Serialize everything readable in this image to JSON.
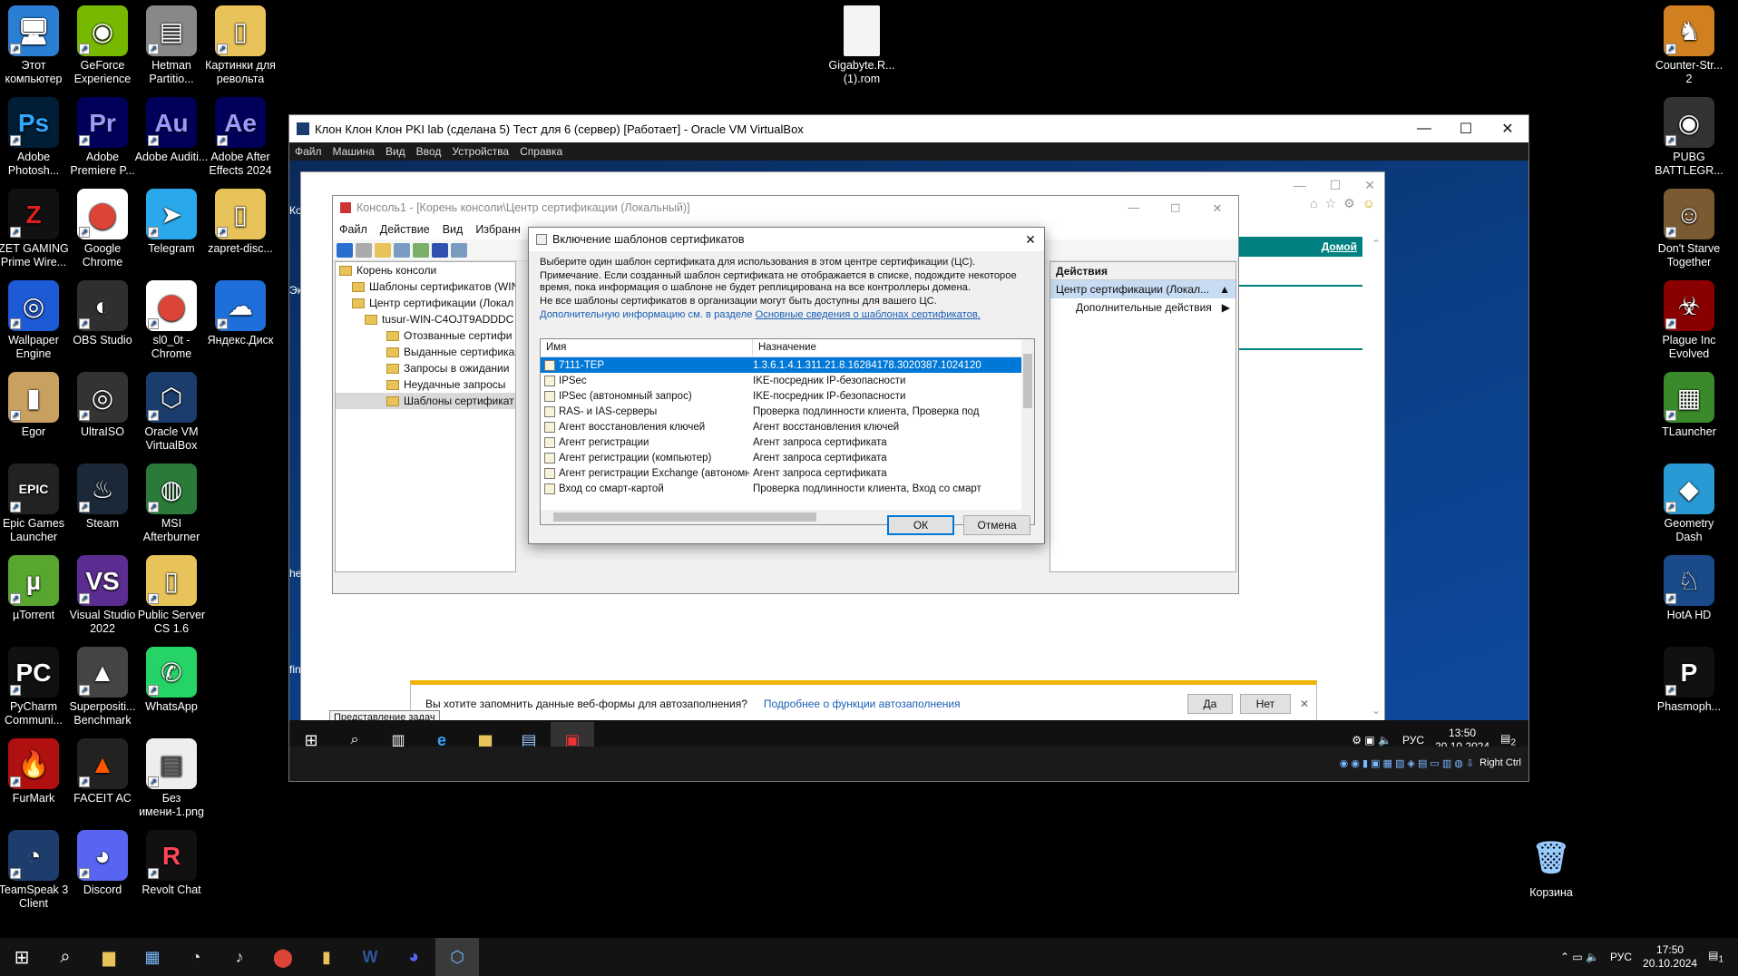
{
  "desktop_left": [
    {
      "l": "Этот компьютер",
      "bg": "#2a7fd4",
      "g": "🖥"
    },
    {
      "l": "Adobe Photosh...",
      "bg": "#001e36",
      "g": "Ps",
      "c": "#31a8ff"
    },
    {
      "l": "ZET GAMING Prime Wire...",
      "bg": "#111",
      "g": "Z",
      "c": "#e02020"
    },
    {
      "l": "Wallpaper Engine",
      "bg": "#1d5ad6",
      "g": "◎"
    },
    {
      "l": "Egor",
      "bg": "#c8a060",
      "g": "▮"
    },
    {
      "l": "Epic Games Launcher",
      "bg": "#222",
      "g": "EPIC"
    },
    {
      "l": "µTorrent",
      "bg": "#58a62f",
      "g": "µ"
    },
    {
      "l": "PyCharm Communi...",
      "bg": "#111",
      "g": "PC"
    },
    {
      "l": "FurMark",
      "bg": "#b01010",
      "g": "🔥"
    },
    {
      "l": "TeamSpeak 3 Client",
      "bg": "#1d3d6d",
      "g": "◔"
    }
  ],
  "desktop_col2": [
    {
      "l": "GeForce Experience",
      "bg": "#76b900",
      "g": "◉"
    },
    {
      "l": "Adobe Premiere P...",
      "bg": "#00005b",
      "g": "Pr",
      "c": "#9999ff"
    },
    {
      "l": "Google Chrome",
      "bg": "#fff",
      "g": "⬤",
      "c": "#db4437"
    },
    {
      "l": "OBS Studio",
      "bg": "#302e31",
      "g": "◐"
    },
    {
      "l": "UltraISO",
      "bg": "#333",
      "g": "◎"
    },
    {
      "l": "Steam",
      "bg": "#1b2838",
      "g": "♨"
    },
    {
      "l": "Visual Studio 2022",
      "bg": "#5c2d91",
      "g": "VS"
    },
    {
      "l": "Superpositi... Benchmark",
      "bg": "#444",
      "g": "▲"
    },
    {
      "l": "FACEIT AC",
      "bg": "#222",
      "g": "▲",
      "c": "#ff5500"
    },
    {
      "l": "Discord",
      "bg": "#5865f2",
      "g": "◕"
    }
  ],
  "desktop_col3": [
    {
      "l": "Hetman Partitio...",
      "bg": "#888",
      "g": "▤"
    },
    {
      "l": "Adobe Auditi...",
      "bg": "#00005b",
      "g": "Au",
      "c": "#9999ff"
    },
    {
      "l": "Telegram",
      "bg": "#29a9eb",
      "g": "➤"
    },
    {
      "l": "sl0_0t - Chrome",
      "bg": "#fff",
      "g": "⬤",
      "c": "#db4437"
    },
    {
      "l": "Oracle VM VirtualBox",
      "bg": "#1a3d6e",
      "g": "⬡"
    },
    {
      "l": "MSI Afterburner",
      "bg": "#2a7a3a",
      "g": "◍"
    },
    {
      "l": "Public Server CS 1.6",
      "bg": "#e8c35a",
      "g": "▯"
    },
    {
      "l": "WhatsApp",
      "bg": "#25d366",
      "g": "✆"
    },
    {
      "l": "Без имени-1.png",
      "bg": "#eee",
      "g": "▤",
      "c": "#555"
    },
    {
      "l": "Revolt Chat",
      "bg": "#111",
      "g": "R",
      "c": "#ff4655"
    }
  ],
  "desktop_col4": [
    {
      "l": "Картинки для револьта",
      "bg": "#e8c35a",
      "g": "▯"
    },
    {
      "l": "Adobe After Effects 2024",
      "bg": "#00005b",
      "g": "Ae",
      "c": "#9999ff"
    },
    {
      "l": "zapret-disc...",
      "bg": "#e8c35a",
      "g": "▯"
    },
    {
      "l": "Яндекс.Диск",
      "bg": "#1e6fd9",
      "g": "☁"
    }
  ],
  "desktop_right": [
    {
      "l": "Counter-Str... 2",
      "bg": "#d08020",
      "g": "♞"
    },
    {
      "l": "PUBG BATTLEGR...",
      "bg": "#333",
      "g": "◉"
    },
    {
      "l": "Don't Starve Together",
      "bg": "#7a5a30",
      "g": "☺"
    },
    {
      "l": "Plague Inc Evolved",
      "bg": "#8a0000",
      "g": "☣"
    },
    {
      "l": "TLauncher",
      "bg": "#3a8a2a",
      "g": "▦"
    },
    {
      "l": "Geometry Dash",
      "bg": "#2a9ad4",
      "g": "◆"
    },
    {
      "l": "HotA HD",
      "bg": "#1a4a8a",
      "g": "♘"
    },
    {
      "l": "Phasmoph...",
      "bg": "#111",
      "g": "P"
    }
  ],
  "gigabyte_label": "Gigabyte.R... (1).rom",
  "recycle_label": "Корзина",
  "vm": {
    "title": "Клон Клон Клон PKI lab (сделана 5) Тест для 6 (сервер) [Работает] - Oracle VM VirtualBox",
    "menu": [
      "Файл",
      "Машина",
      "Вид",
      "Ввод",
      "Устройства",
      "Справка"
    ],
    "host_key": "Right Ctrl"
  },
  "mmc": {
    "title": "Консоль1 - [Корень консоли\\Центр сертификации (Локальный)]",
    "menu": [
      "Файл",
      "Действие",
      "Вид",
      "Избранн"
    ],
    "tree": [
      "Корень консоли",
      "Шаблоны сертификатов (WIN",
      "Центр сертификации (Локал",
      "tusur-WIN-C4OJT9ADDDC",
      "Отозванные сертифи",
      "Выданные сертифика",
      "Запросы в ожидании",
      "Неудачные запросы",
      "Шаблоны сертификат"
    ],
    "actions_header": "Действия",
    "actions_sel": "Центр сертификации (Локал...",
    "actions_more": "Дополнительные действия"
  },
  "dialog": {
    "title": "Включение шаблонов сертификатов",
    "line1": "Выберите один шаблон сертификата для использования в этом центре сертификации (ЦС).",
    "line2": "Примечание. Если созданный шаблон сертификата не отображается в списке, подождите некоторое время, пока информация о шаблоне не будет реплицирована на все контроллеры домена.",
    "line3": "Не все шаблоны сертификатов в организации могут быть доступны для вашего ЦС.",
    "link_prefix": "Дополнительную информацию см. в разделе ",
    "link": "Основные сведения о шаблонах сертификатов.",
    "col1": "Имя",
    "col2": "Назначение",
    "rows": [
      [
        "7111-TEP",
        "1.3.6.1.4.1.311.21.8.16284178.3020387.1024120"
      ],
      [
        "IPSec",
        "IKE-посредник IP-безопасности"
      ],
      [
        "IPSec (автономный запрос)",
        "IKE-посредник IP-безопасности"
      ],
      [
        "RAS- и IAS-серверы",
        "Проверка подлинности клиента, Проверка под"
      ],
      [
        "Агент восстановления ключей",
        "Агент восстановления ключей"
      ],
      [
        "Агент регистрации",
        "Агент запроса сертификата"
      ],
      [
        "Агент регистрации (компьютер)",
        "Агент запроса сертификата"
      ],
      [
        "Агент регистрации Exchange (автономный запрос)",
        "Агент запроса сертификата"
      ],
      [
        "Вход со смарт-картой",
        "Проверка подлинности клиента, Вход со смарт"
      ]
    ],
    "ok": "ОК",
    "cancel": "Отмена"
  },
  "ie": {
    "home_link": "Домой"
  },
  "autofill": {
    "q": "Вы хотите запомнить данные веб-формы для автозаполнения?",
    "link": "Подробнее о функции автозаполнения",
    "yes": "Да",
    "no": "Нет"
  },
  "tooltip": "Представление задач",
  "guest_tray": {
    "lang": "РУС",
    "time": "13:50",
    "date": "20.10.2024",
    "badge": "2"
  },
  "guest_desk_labels": [
    "Кор",
    "Экс",
    "hel",
    "finis"
  ],
  "host_tray": {
    "lang": "РУС",
    "time": "17:50",
    "date": "20.10.2024",
    "badge": "1"
  }
}
